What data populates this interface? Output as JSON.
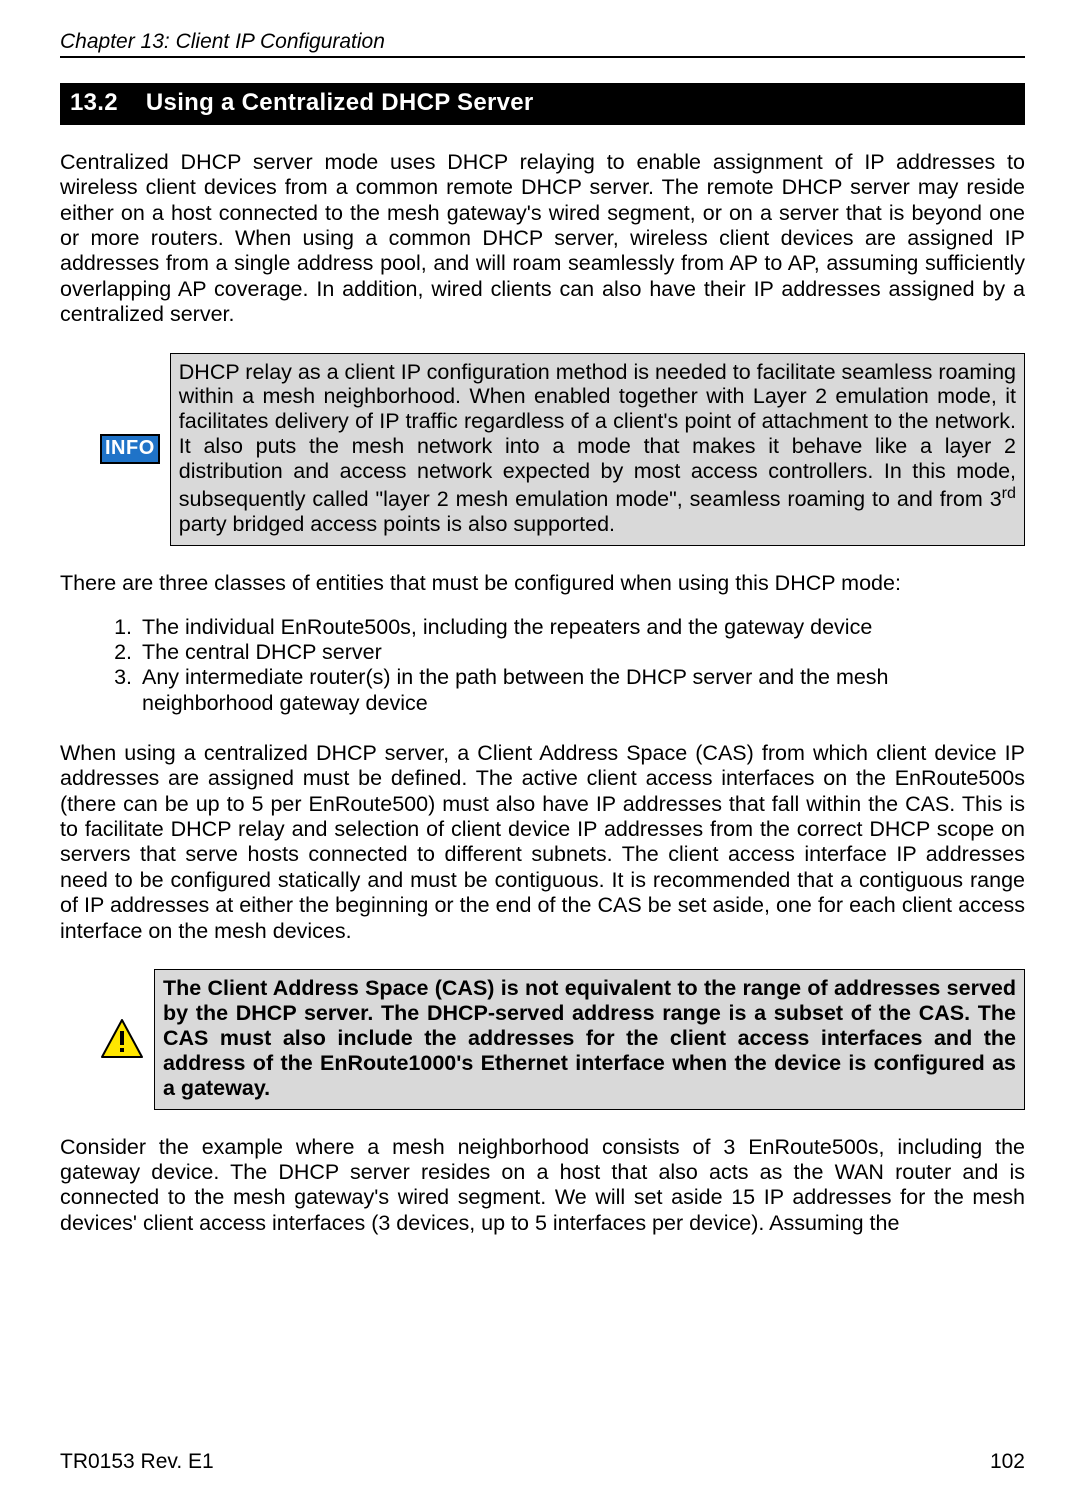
{
  "header": {
    "chapter": "Chapter 13: Client IP Configuration"
  },
  "section": {
    "number": "13.2",
    "title": "Using a Centralized DHCP Server"
  },
  "paragraphs": {
    "p1": "Centralized DHCP server mode uses DHCP relaying to enable assignment of IP addresses to wireless client devices from a common remote DHCP server. The remote DHCP server may reside either on a host connected to the mesh gateway's wired segment, or on a server that is beyond one or more routers. When using a common DHCP server, wireless client devices are assigned IP addresses from a single address pool, and will roam seamlessly from AP to AP, assuming sufficiently overlapping AP coverage. In addition, wired clients can also have their IP addresses assigned by a centralized server.",
    "info_pre": "DHCP relay as a client IP configuration method is needed to facilitate seamless roaming within a mesh neighborhood. When enabled together with Layer 2 emulation mode, it facilitates delivery of IP traffic regardless of a client's point of attachment to the network. It also puts the mesh network into a mode that makes it behave like a layer 2 distribution and access network expected by most access controllers. In this mode, subsequently called \"layer 2 mesh emulation mode\", seamless roaming to and from 3",
    "info_sup": "rd",
    "info_post": " party bridged access points is also supported.",
    "p2": "There are three classes of entities that must be configured when using this DHCP mode:",
    "p3": "When using a centralized DHCP server, a Client Address Space (CAS) from which client device IP addresses are assigned must be defined. The active client access interfaces on the EnRoute500s (there can be up to 5 per EnRoute500) must also have IP addresses that fall within the CAS. This is to facilitate DHCP relay and selection of client device IP addresses from the correct DHCP scope on servers that serve hosts connected to different subnets. The client access interface IP addresses need to be configured statically and must be contiguous. It is recommended that a contiguous range of IP addresses at either the beginning or the end of the CAS be set aside, one for each client access interface on the mesh devices.",
    "warn": "The Client Address Space (CAS) is not equivalent to the range of addresses served by the DHCP server. The DHCP-served address range is a subset of the CAS. The CAS must also include the addresses for the client access interfaces and the address of the EnRoute1000's Ethernet interface when the device is configured as a gateway.",
    "p4": "Consider the example where a mesh neighborhood consists of 3 EnRoute500s, including the gateway device. The DHCP server resides on a host that also acts as the WAN router and is connected to the mesh gateway's wired segment. We will set aside 15 IP addresses for the mesh devices' client access interfaces (3 devices, up to 5 interfaces per device). Assuming the"
  },
  "list": {
    "item1": "The individual EnRoute500s, including the repeaters and the gateway device",
    "item2": "The central DHCP server",
    "item3": "Any intermediate router(s) in the path between the DHCP server and the mesh neighborhood gateway device"
  },
  "icons": {
    "info_label": "INFO"
  },
  "footer": {
    "left": "TR0153 Rev. E1",
    "right": "102"
  }
}
